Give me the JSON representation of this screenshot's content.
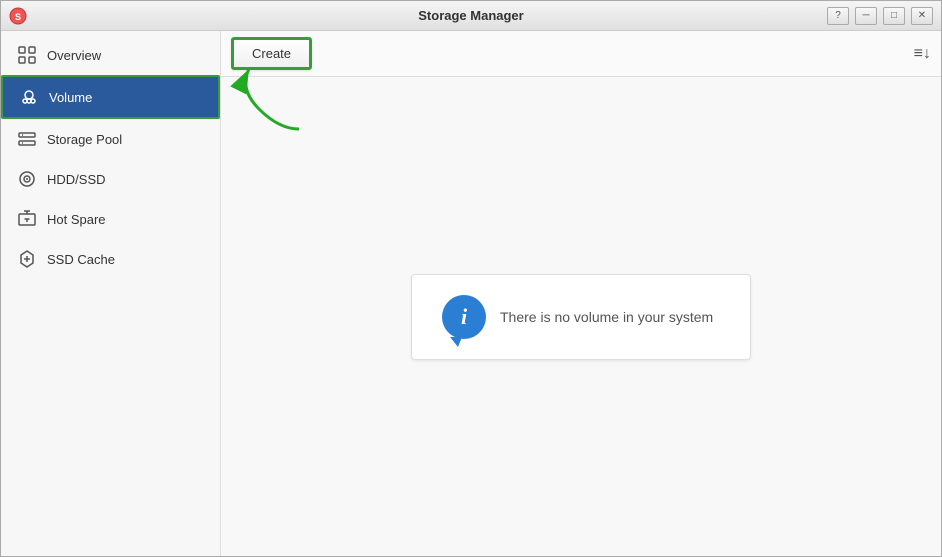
{
  "window": {
    "title": "Storage Manager",
    "controls": {
      "help": "?",
      "minimize": "─",
      "maximize": "□",
      "close": "✕"
    }
  },
  "sidebar": {
    "items": [
      {
        "id": "overview",
        "label": "Overview",
        "icon": "grid-icon",
        "active": false
      },
      {
        "id": "volume",
        "label": "Volume",
        "icon": "volume-icon",
        "active": true
      },
      {
        "id": "storage-pool",
        "label": "Storage Pool",
        "icon": "storage-pool-icon",
        "active": false
      },
      {
        "id": "hdd-ssd",
        "label": "HDD/SSD",
        "icon": "hdd-icon",
        "active": false
      },
      {
        "id": "hot-spare",
        "label": "Hot Spare",
        "icon": "hot-spare-icon",
        "active": false
      },
      {
        "id": "ssd-cache",
        "label": "SSD Cache",
        "icon": "ssd-cache-icon",
        "active": false
      }
    ]
  },
  "toolbar": {
    "create_label": "Create",
    "sort_icon": "sort-icon"
  },
  "content": {
    "empty_message": "There is no volume in your system"
  }
}
